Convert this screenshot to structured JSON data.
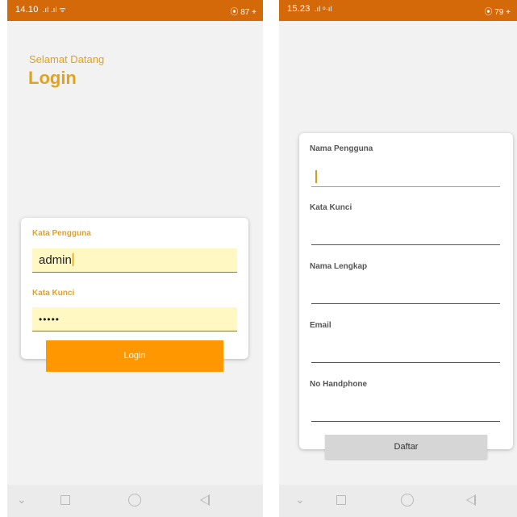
{
  "left_screen": {
    "status_bar": {
      "time": "14.10",
      "signal": ".ıl .ıl ᯤ",
      "right": "⦿ 87 +"
    },
    "greeting": "Selamat Datang",
    "title": "Login",
    "form": {
      "username_label": "Kata Pengguna",
      "username_value": "admin",
      "password_label": "Kata Kunci",
      "password_value": "•••••"
    },
    "login_button": "Login"
  },
  "right_screen": {
    "status_bar": {
      "time": "15.23",
      "signal": ".ıl ᵒ·ıl",
      "right": "⦿ 79 +"
    },
    "form": {
      "fields": [
        {
          "label": "Nama Pengguna",
          "value": ""
        },
        {
          "label": "Kata Kunci",
          "value": ""
        },
        {
          "label": "Nama Lengkap",
          "value": ""
        },
        {
          "label": "Email",
          "value": ""
        },
        {
          "label": "No Handphone",
          "value": ""
        }
      ]
    },
    "register_button": "Daftar"
  },
  "navigation": {
    "icons": [
      "chevron-down-icon",
      "recent-apps-icon",
      "home-icon",
      "back-icon"
    ]
  },
  "colors": {
    "status_bar": "#d4690a",
    "accent": "#e3a21a",
    "login_button": "#ff9800",
    "input_fill": "#fff8c2",
    "register_button": "#d6d6d6"
  }
}
